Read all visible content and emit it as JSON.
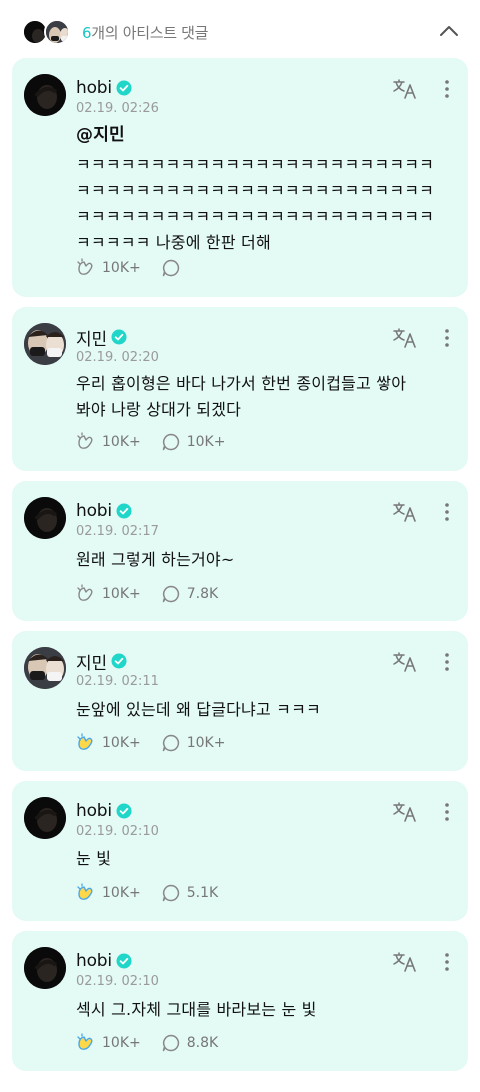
{
  "header": {
    "count": "6",
    "label": "개의 아티스트 댓글"
  },
  "comments": [
    {
      "author": "hobi",
      "time": "02.19. 02:26",
      "mention": "@지민",
      "text": "ㅋㅋㅋㅋㅋㅋㅋㅋㅋㅋㅋㅋㅋㅋㅋㅋㅋㅋㅋㅋㅋㅋㅋㅋㅋㅋㅋㅋㅋㅋㅋㅋㅋㅋㅋㅋㅋㅋㅋㅋㅋㅋㅋㅋㅋㅋㅋㅋㅋㅋㅋㅋㅋㅋㅋㅋㅋㅋㅋㅋㅋㅋㅋㅋㅋㅋㅋㅋㅋㅋㅋㅋㅋㅋㅋㅋㅋ 나중에 한판 더해",
      "likes": "10K+",
      "replies": ""
    },
    {
      "author": "지민",
      "time": "02.19. 02:20",
      "mention": "",
      "text": "우리 홉이형은 바다 나가서 한번 종이컵들고 쌓아봐야 나랑 상대가 되겠다",
      "likes": "10K+",
      "replies": "10K+"
    },
    {
      "author": "hobi",
      "time": "02.19. 02:17",
      "mention": "",
      "text": "원래 그렇게 하는거야~",
      "likes": "10K+",
      "replies": "7.8K"
    },
    {
      "author": "지민",
      "time": "02.19. 02:11",
      "mention": "",
      "text": "눈앞에 있는데 왜 답글다냐고 ㅋㅋㅋ",
      "likes": "10K+",
      "replies": "10K+"
    },
    {
      "author": "hobi",
      "time": "02.19. 02:10",
      "mention": "",
      "text": "눈 빛",
      "likes": "10K+",
      "replies": "5.1K"
    },
    {
      "author": "hobi",
      "time": "02.19. 02:10",
      "mention": "",
      "text": "섹시 그.자체 그대를 바라보는 눈 빛",
      "likes": "10K+",
      "replies": "8.8K"
    }
  ],
  "colors": {
    "card_bg": "#e3faf5",
    "accent": "#18c7c2",
    "verified": "#1fd6c8",
    "muted": "#9a9a9a"
  },
  "icons": {
    "collapse": "chevron-up-icon",
    "translate": "translate-icon",
    "more": "more-vertical-icon",
    "like": "cheer-icon",
    "reply": "reply-bubble-icon",
    "verified": "verified-badge-icon"
  }
}
